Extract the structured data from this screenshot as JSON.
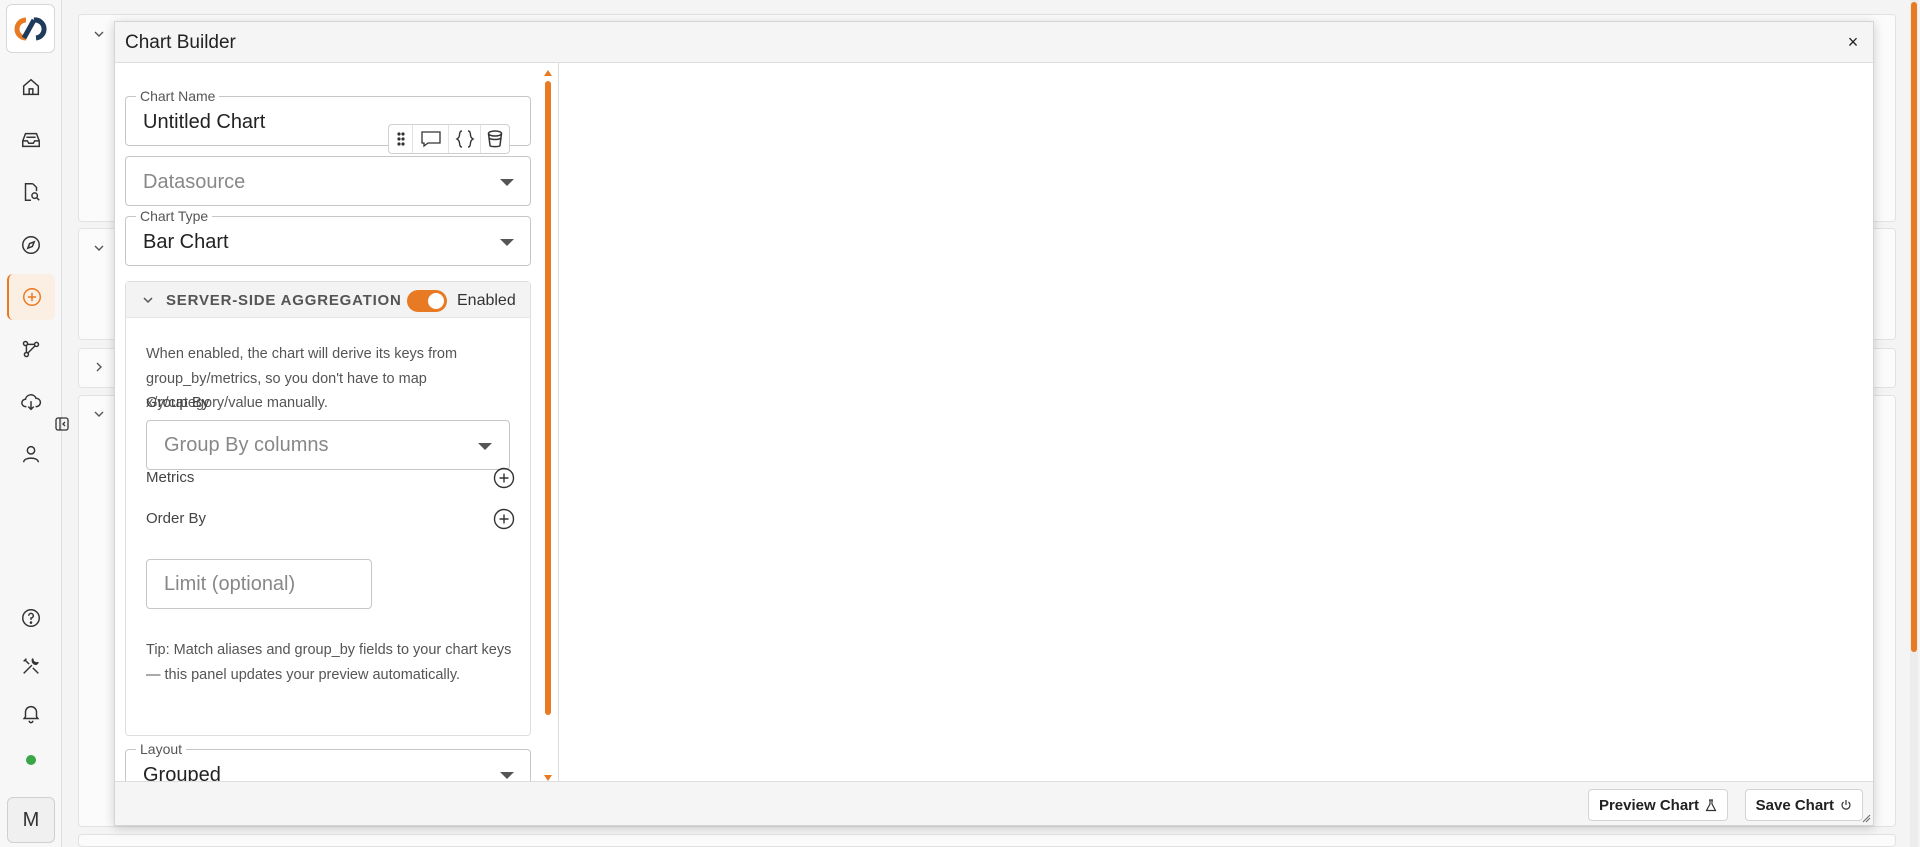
{
  "app": {
    "avatar_initial": "M"
  },
  "nav": [
    {
      "icon": "home-icon"
    },
    {
      "icon": "inbox-icon"
    },
    {
      "icon": "file-search-icon"
    },
    {
      "icon": "compass-icon"
    },
    {
      "icon": "add-circle-icon",
      "active": true
    },
    {
      "icon": "graph-nodes-icon"
    },
    {
      "icon": "cloud-download-icon"
    },
    {
      "icon": "user-icon"
    },
    {
      "icon": "help-icon"
    },
    {
      "icon": "tools-icon"
    },
    {
      "icon": "bell-icon"
    }
  ],
  "status": {
    "online_color": "#3aa64a"
  },
  "theme": {
    "accent": "#e77a22"
  },
  "dialog": {
    "title": "Chart Builder",
    "close_label": "×",
    "chart_name": {
      "label": "Chart Name",
      "value": "Untitled Chart"
    },
    "datasource": {
      "placeholder": "Datasource"
    },
    "chart_type": {
      "label": "Chart Type",
      "value": "Bar Chart"
    },
    "aggregation": {
      "title": "SERVER-SIDE AGGREGATION",
      "enabled": true,
      "toggle_label": "Enabled",
      "description": "When enabled, the chart will derive its keys from group_by/metrics, so you don't have to map x/y/category/value manually.",
      "group_by": {
        "label": "Group By",
        "placeholder": "Group By columns"
      },
      "metrics": {
        "label": "Metrics"
      },
      "order_by": {
        "label": "Order By"
      },
      "limit": {
        "placeholder": "Limit (optional)"
      },
      "tip": "Tip: Match aliases and group_by fields to your chart keys — this panel updates your preview automatically."
    },
    "layout": {
      "label": "Layout",
      "value": "Grouped"
    },
    "footer": {
      "preview_label": "Preview Chart",
      "save_label": "Save Chart"
    }
  }
}
